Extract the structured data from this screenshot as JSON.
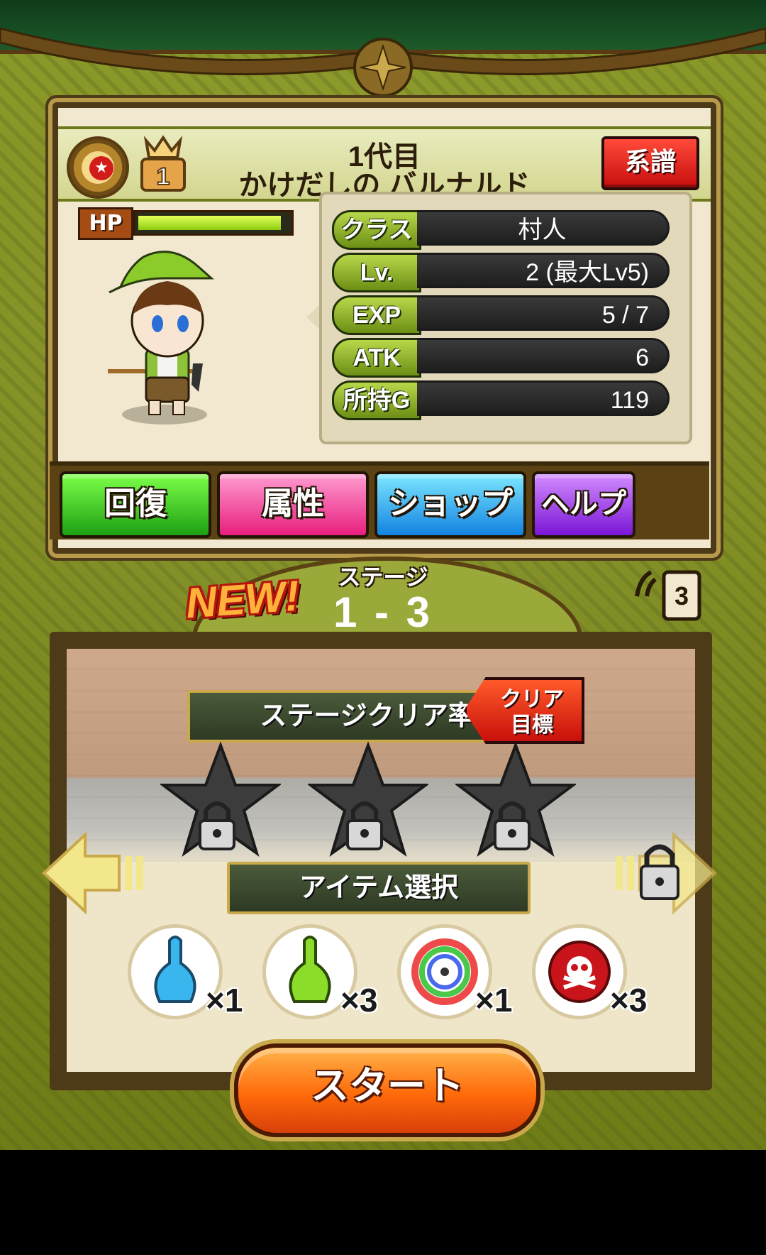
{
  "header": {
    "generation": "1代目",
    "character_name": "かけだしの バルナルド",
    "lineage_button": "系譜",
    "rank_number": "1",
    "medal_icon": "star-medal-icon"
  },
  "hp": {
    "label": "HP",
    "fraction": 0.95
  },
  "stats": [
    {
      "key": "クラス",
      "value": "村人",
      "align": "center"
    },
    {
      "key": "Lv.",
      "value": "2 (最大Lv5)",
      "align": "right"
    },
    {
      "key": "EXP",
      "value": "5 / 7",
      "align": "right"
    },
    {
      "key": "ATK",
      "value": "6",
      "align": "right"
    },
    {
      "key": "所持G",
      "value": "119",
      "align": "right"
    }
  ],
  "actions": {
    "heal": "回復",
    "attribute": "属性",
    "shop": "ショップ",
    "help": "ヘルプ"
  },
  "stage": {
    "new_badge": "NEW!",
    "label": "ステージ",
    "number": "1 - 3",
    "sound_level": "3"
  },
  "clear": {
    "ribbon": "ステージクリア率",
    "target_line1": "クリア",
    "target_line2": "目標",
    "stars_locked": 3
  },
  "items": {
    "ribbon": "アイテム選択",
    "list": [
      {
        "icon": "blue-potion-icon",
        "count": "×1"
      },
      {
        "icon": "green-potion-icon",
        "count": "×3"
      },
      {
        "icon": "rainbow-compass-icon",
        "count": "×1"
      },
      {
        "icon": "skull-bomb-icon",
        "count": "×3"
      }
    ]
  },
  "start_button": "スタート",
  "colors": {
    "accent_green": "#8ccc10",
    "lineage_red": "#c80e0e",
    "start_orange": "#ff6a0a"
  }
}
